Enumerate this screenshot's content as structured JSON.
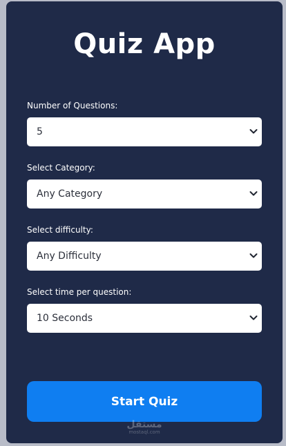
{
  "app": {
    "title": "Quiz App"
  },
  "form": {
    "fields": [
      {
        "label": "Number of Questions:",
        "value": "5"
      },
      {
        "label": "Select Category:",
        "value": "Any Category"
      },
      {
        "label": "Select difficulty:",
        "value": "Any Difficulty"
      },
      {
        "label": "Select time per question:",
        "value": "10 Seconds"
      }
    ],
    "start_label": "Start Quiz"
  },
  "watermark": {
    "main": "مستقل",
    "sub": "mostaql.com"
  },
  "colors": {
    "page_background": "#b8bcc8",
    "card_background": "#1f2a48",
    "button_accent": "#0f7ef1",
    "text_light": "#ffffff"
  },
  "icons": {
    "select_arrow": "chevron-down-icon"
  }
}
